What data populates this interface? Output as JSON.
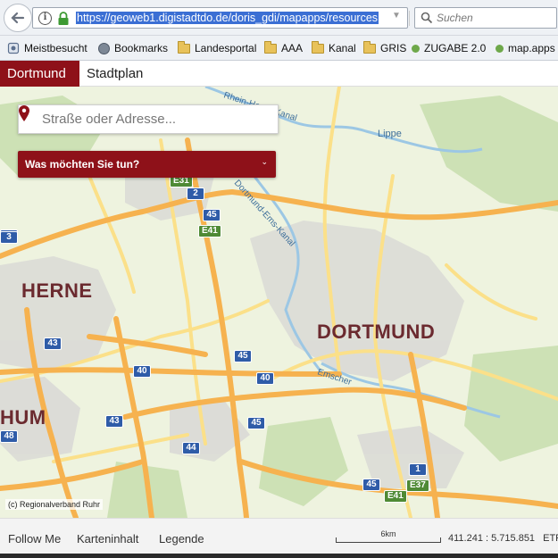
{
  "browser": {
    "url": "https://geoweb1.digistadtdo.de/doris_gdi/mapapps/resources",
    "search_placeholder": "Suchen",
    "bookmarks": [
      {
        "label": "Meistbesucht",
        "icon": "gear-icon"
      },
      {
        "label": "Bookmarks",
        "icon": "globe-icon"
      },
      {
        "label": "Landesportal",
        "icon": "folder-icon"
      },
      {
        "label": "AAA",
        "icon": "folder-icon"
      },
      {
        "label": "Kanal",
        "icon": "folder-icon"
      },
      {
        "label": "GRIS",
        "icon": "folder-icon"
      },
      {
        "label": "ZUGABE 2.0",
        "icon": "dot-icon"
      },
      {
        "label": "map.apps",
        "icon": "dot-icon"
      }
    ]
  },
  "app": {
    "brand": "Dortmund",
    "title": "Stadtplan"
  },
  "map": {
    "address_placeholder": "Straße oder Adresse...",
    "action_label": "Was möchten Sie tun?",
    "copyright": "(c) Regionalverband Ruhr",
    "cities": [
      "HERNE",
      "DORTMUND",
      "HUM"
    ],
    "waterways": [
      "Rhein-Herne-Kanal",
      "Dortmund-Ems-Kanal",
      "Lippe",
      "Emscher"
    ],
    "road_shields": [
      "2",
      "45",
      "E41",
      "43",
      "40",
      "45",
      "40",
      "43",
      "45",
      "44",
      "1",
      "E37",
      "45",
      "E41",
      "48",
      "43",
      "E31",
      "3"
    ],
    "colors": {
      "land": "#eef3df",
      "urban": "#d9d9d6",
      "forest": "#c9dfb0",
      "motorway": "#f6b24f",
      "primary": "#fbe089",
      "water": "#9cc7e4"
    }
  },
  "footer": {
    "follow_me": "Follow Me",
    "map_content": "Karteninhalt",
    "legend": "Legende",
    "scale": "6km",
    "coords": "411.241 : 5.715.851",
    "crs": "ETR"
  },
  "colors": {
    "brand": "#8e1119"
  }
}
